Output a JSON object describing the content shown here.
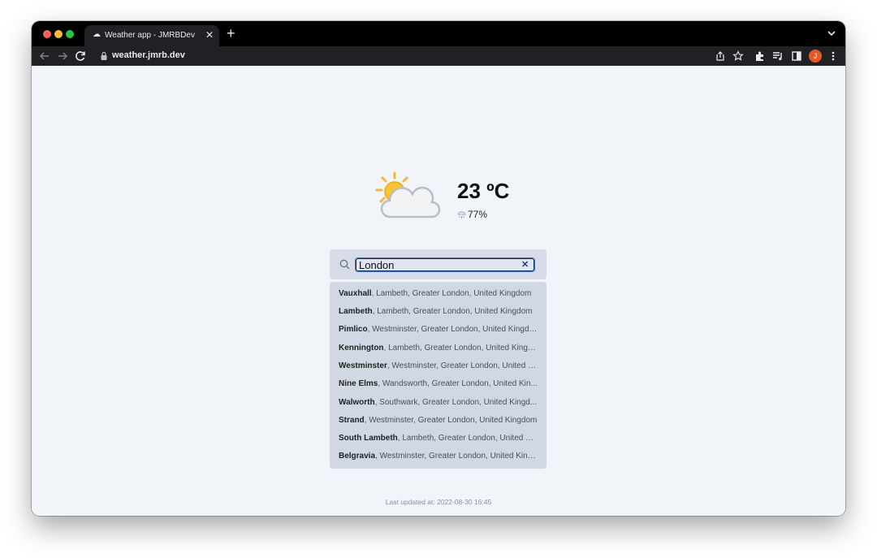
{
  "browser": {
    "tab_title": "Weather app - JMRBDev",
    "url": "weather.jmrb.dev",
    "avatar_initial": "J"
  },
  "weather": {
    "temperature": "23 ºC",
    "humidity": "77%",
    "icon": "partly-cloudy-icon"
  },
  "search": {
    "value": "London",
    "suggestions": [
      {
        "name": "Vauxhall",
        "detail": ", Lambeth, Greater London, United Kingdom"
      },
      {
        "name": "Lambeth",
        "detail": ", Lambeth, Greater London, United Kingdom"
      },
      {
        "name": "Pimlico",
        "detail": ", Westminster, Greater London, United Kingdo..."
      },
      {
        "name": "Kennington",
        "detail": ", Lambeth, Greater London, United Kingd..."
      },
      {
        "name": "Westminster",
        "detail": ", Westminster, Greater London, United K..."
      },
      {
        "name": "Nine Elms",
        "detail": ", Wandsworth, Greater London, United Kin..."
      },
      {
        "name": "Walworth",
        "detail": ", Southwark, Greater London, United Kingd..."
      },
      {
        "name": "Strand",
        "detail": ", Westminster, Greater London, United Kingdom"
      },
      {
        "name": "South Lambeth",
        "detail": ", Lambeth, Greater London, United Ki..."
      },
      {
        "name": "Belgravia",
        "detail": ", Westminster, Greater London, United King..."
      }
    ]
  },
  "footer": {
    "last_updated": "Last updated at: 2022-08-30 16:45"
  }
}
